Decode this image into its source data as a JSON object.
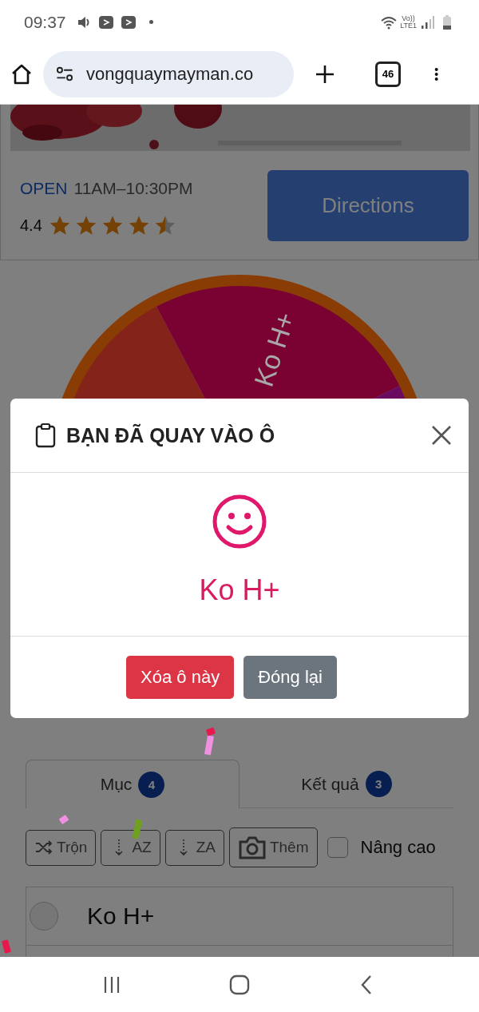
{
  "status_bar": {
    "time": "09:37",
    "volte": "Vo))",
    "network": "LTE1"
  },
  "browser": {
    "url": "vongquaymayman.co",
    "tab_count": "46"
  },
  "ad": {
    "open_label": "OPEN",
    "hours": "11AM–10:30PM",
    "rating": "4.4",
    "stars": 4.5,
    "button": "Directions"
  },
  "wheel": {
    "segments": [
      {
        "color": "#84231a"
      },
      {
        "label": "Ko H+",
        "color": "#7a0232"
      },
      {
        "color": "#6a0a60"
      }
    ]
  },
  "modal": {
    "title": "BẠN ĐÃ QUAY VÀO Ô",
    "result": "Ko H+",
    "buttons": [
      {
        "label": "Xóa ô này",
        "kind": "danger"
      },
      {
        "label": "Đóng lại",
        "kind": "secondary"
      }
    ]
  },
  "tabs": [
    {
      "label": "Mục",
      "count": "4",
      "selected": true
    },
    {
      "label": "Kết quả",
      "count": "3",
      "selected": false
    }
  ],
  "toolbar": [
    {
      "label": "Trộn",
      "kind": "shuffle"
    },
    {
      "label": "AZ",
      "kind": "sort"
    },
    {
      "label": "ZA",
      "kind": "sort"
    },
    {
      "label": "Thêm",
      "kind": "camera"
    }
  ],
  "advanced": {
    "label": "Nâng cao",
    "checked": false
  },
  "items": [
    {
      "label": "Ko H+",
      "selected": false
    }
  ]
}
